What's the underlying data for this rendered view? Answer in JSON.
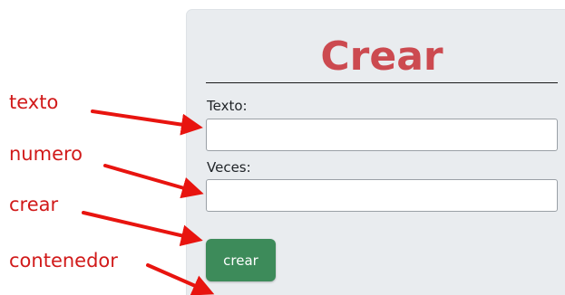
{
  "form": {
    "title": "Crear",
    "texto_label": "Texto:",
    "texto_value": "",
    "veces_label": "Veces:",
    "veces_value": "",
    "button_label": "crear"
  },
  "annotations": {
    "texto": "texto",
    "numero": "numero",
    "crear": "crear",
    "contenedor": "contenedor"
  },
  "colors": {
    "title": "#cc4a50",
    "panel_bg": "#e9ecef",
    "button_bg": "#3d8b5a",
    "annotation": "#d11a1a"
  }
}
